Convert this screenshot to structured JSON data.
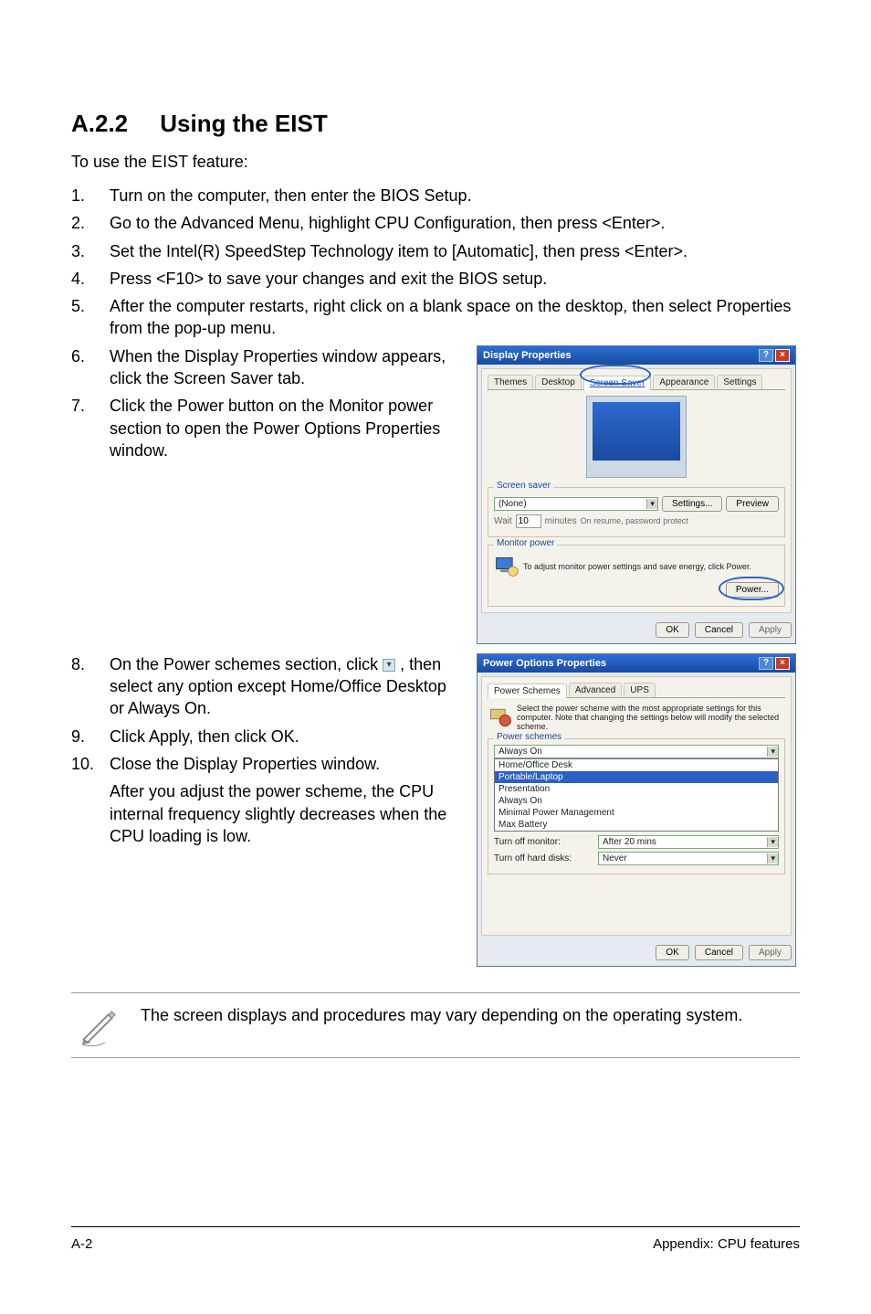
{
  "section": {
    "number": "A.2.2",
    "title": "Using the EIST"
  },
  "intro": "To use the EIST feature:",
  "steps_top": [
    {
      "n": "1.",
      "t": "Turn on the computer, then enter the BIOS Setup."
    },
    {
      "n": "2.",
      "t": "Go to the Advanced Menu, highlight CPU Configuration, then press <Enter>."
    },
    {
      "n": "3.",
      "t": "Set the Intel(R) SpeedStep Technology item to [Automatic], then press <Enter>."
    },
    {
      "n": "4.",
      "t": "Press <F10> to save your changes and exit the BIOS setup."
    },
    {
      "n": "5.",
      "t": "After the computer restarts, right click on a blank space on the desktop, then select Properties from the pop-up menu."
    }
  ],
  "steps_mid": [
    {
      "n": "6.",
      "t": "When the Display Properties window appears, click the Screen Saver tab."
    },
    {
      "n": "7.",
      "t": "Click the Power button on the Monitor power section to open the Power Options Properties window."
    }
  ],
  "steps_bottom_a": [
    {
      "n": "8.",
      "t_pre": "On the Power schemes section, click ",
      "t_post": " , then select any option except Home/Office Desktop or Always On."
    },
    {
      "n": "9.",
      "t": "Click Apply, then click OK."
    },
    {
      "n": "10.",
      "t": "Close the Display Properties window."
    }
  ],
  "after_note": "After you adjust the power scheme, the CPU internal frequency slightly decreases when the CPU loading is low.",
  "display_dlg": {
    "title": "Display Properties",
    "tabs": [
      "Themes",
      "Desktop",
      "Screen Saver",
      "Appearance",
      "Settings"
    ],
    "screensaver_group": "Screen saver",
    "ss_combo": "(None)",
    "ss_settings": "Settings...",
    "ss_preview": "Preview",
    "wait_label": "Wait",
    "wait_value": "10",
    "wait_min": "minutes",
    "wait_resume": "On resume, password protect",
    "monitor_group": "Monitor power",
    "monitor_text": "To adjust monitor power settings and save energy, click Power.",
    "power_btn": "Power...",
    "ok": "OK",
    "cancel": "Cancel",
    "apply": "Apply"
  },
  "power_dlg": {
    "title": "Power Options Properties",
    "tabs": [
      "Power Schemes",
      "Advanced",
      "UPS"
    ],
    "desc": "Select the power scheme with the most appropriate settings for this computer. Note that changing the settings below will modify the selected scheme.",
    "ps_group": "Power schemes",
    "ps_selected": "Always On",
    "ps_options": [
      "Home/Office Desk",
      "Portable/Laptop",
      "Presentation",
      "Always On",
      "Minimal Power Management",
      "Max Battery"
    ],
    "settings_for": "Turn off monitor:",
    "monitor_val": "After 20 mins",
    "hdd_label": "Turn off hard disks:",
    "hdd_val": "Never",
    "ok": "OK",
    "cancel": "Cancel",
    "apply": "Apply"
  },
  "note_text": "The screen displays and procedures may vary depending on the operating system.",
  "footer": {
    "left": "A-2",
    "right": "Appendix: CPU features"
  }
}
